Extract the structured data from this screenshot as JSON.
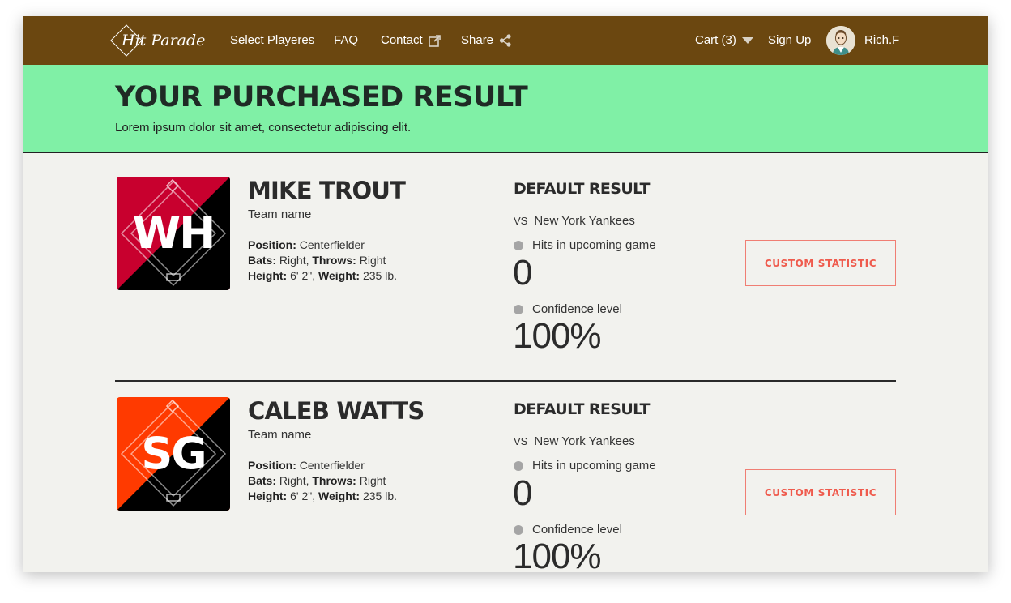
{
  "nav": {
    "logo": "Hit Parade",
    "items": [
      "Select Playeres",
      "FAQ",
      "Contact",
      "Share"
    ],
    "cart": "Cart (3)",
    "signup": "Sign Up",
    "user": "Rich.F",
    "icons": [
      "external-link-icon",
      "share-icon",
      "caret-down-icon"
    ]
  },
  "hero": {
    "title": "YOUR PURCHASED RESULT",
    "subtitle": "Lorem ipsum dolor sit amet, consectetur adipiscing elit."
  },
  "players": [
    {
      "badge": "WH",
      "badge_color": "#c8002e",
      "name": "MIKE TROUT",
      "team": "Team name",
      "position_label": "Position:",
      "position": "Centerfielder",
      "bats_label": "Bats:",
      "bats": "Right,",
      "throws_label": "Throws:",
      "throws": "Right",
      "height_label": "Height:",
      "height": "6' 2\",",
      "weight_label": "Weight:",
      "weight": "235 lb.",
      "result_title": "DEFAULT RESULT",
      "vs_label": "VS",
      "opponent": "New York Yankees",
      "hits_label": "Hits in upcoming game",
      "hits_value": "0",
      "conf_label": "Confidence level",
      "conf_value": "100%",
      "button": "CUSTOM STATISTIC"
    },
    {
      "badge": "SG",
      "badge_color": "#ff3a00",
      "name": "CALEB WATTS",
      "team": "Team name",
      "position_label": "Position:",
      "position": "Centerfielder",
      "bats_label": "Bats:",
      "bats": "Right,",
      "throws_label": "Throws:",
      "throws": "Right",
      "height_label": "Height:",
      "height": "6' 2\",",
      "weight_label": "Weight:",
      "weight": "235 lb.",
      "result_title": "DEFAULT RESULT",
      "vs_label": "VS",
      "opponent": "New York Yankees",
      "hits_label": "Hits in upcoming game",
      "hits_value": "0",
      "conf_label": "Confidence level",
      "conf_value": "100%",
      "button": "CUSTOM STATISTIC"
    }
  ],
  "colors": {
    "nav_bg": "#6b4710",
    "hero_bg": "#80f0a6",
    "accent": "#ef5b4d"
  }
}
